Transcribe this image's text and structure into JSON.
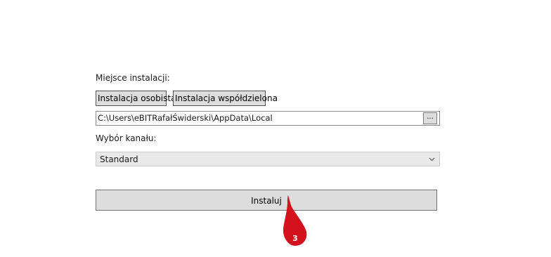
{
  "install": {
    "location_label": "Miejsce instalacji:",
    "personal_button": "Instalacja osobista",
    "shared_button": "Instalacja współdzielona",
    "path_value": "C:\\Users\\eBITRafałŚwiderski\\AppData\\Local",
    "browse_label": "...",
    "channel_label": "Wybór kanału:",
    "channel_selected": "Standard",
    "install_button": "Instaluj"
  },
  "annotation": {
    "step_number": "3",
    "color": "#d4121e"
  }
}
